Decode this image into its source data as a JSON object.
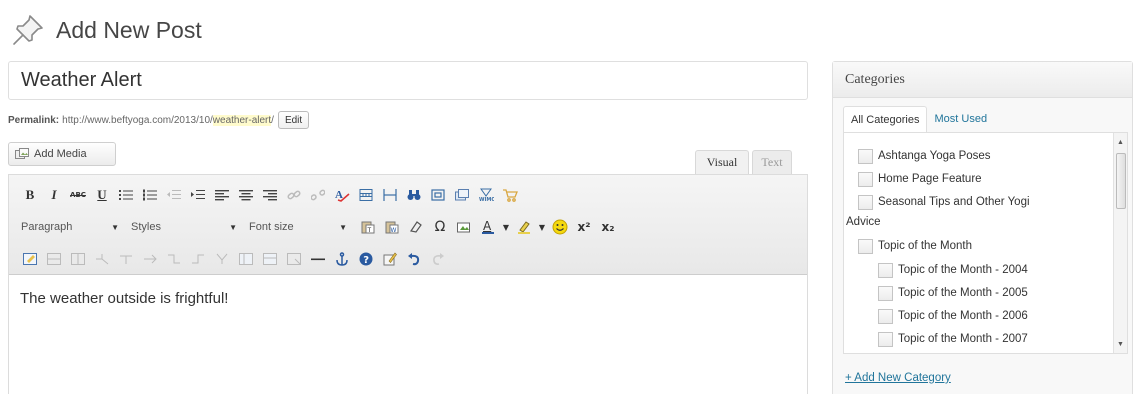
{
  "header": {
    "title": "Add New Post",
    "icon": "pushpin-icon"
  },
  "post": {
    "title_value": "Weather Alert",
    "title_placeholder": ""
  },
  "permalink": {
    "label": "Permalink:",
    "base_url": "http://www.beftyoga.com/2013/10/",
    "slug": "weather-alert",
    "trailing": "/",
    "edit_label": "Edit"
  },
  "media": {
    "add_label": "Add Media",
    "icon": "media-icon"
  },
  "editor_tabs": {
    "visual": "Visual",
    "text": "Text",
    "active": "Visual"
  },
  "toolbar": {
    "bold": "B",
    "italic": "I",
    "strikethrough": "ABC",
    "underline": "U",
    "format_select": "Paragraph",
    "styles_select": "Styles",
    "fontsize_select": "Font size",
    "omega": "Ω",
    "superscript": "x²",
    "subscript": "x₂"
  },
  "editor": {
    "content": "The weather outside is frightful!"
  },
  "categories": {
    "title": "Categories",
    "tabs": [
      "All Categories",
      "Most Used"
    ],
    "active_tab": "All Categories",
    "items": [
      {
        "label": "Ashtanga Yoga Poses",
        "checked": false
      },
      {
        "label": "Home Page Feature",
        "checked": false
      },
      {
        "label": "Seasonal Tips and Other Yogi",
        "label_cont": "Advice",
        "checked": false
      },
      {
        "label": "Topic of the Month",
        "checked": false
      },
      {
        "label": "Topic of the Month - 2004",
        "checked": false
      },
      {
        "label": "Topic of the Month - 2005",
        "checked": false
      },
      {
        "label": "Topic of the Month - 2006",
        "checked": false
      },
      {
        "label": "Topic of the Month - 2007",
        "checked": false
      }
    ],
    "add_new_label": "+ Add New Category"
  },
  "colors": {
    "link": "#21759b",
    "slug_highlight": "#fffbcc",
    "border": "#dfdfdf"
  }
}
